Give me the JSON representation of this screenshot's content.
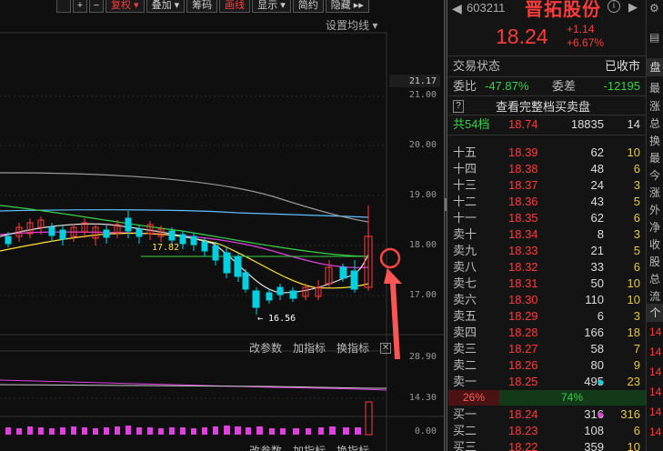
{
  "toolbar": {
    "buttons": [
      "",
      "+",
      "−",
      "复权 ▾",
      "叠加 ▾",
      "筹码",
      "画线",
      "显示 ▾",
      "简约",
      "隐藏 ▸▸"
    ]
  },
  "main_chart": {
    "ma_setting_label": "设置均线 ▾",
    "axis_labels": [
      "21.17",
      "21.00",
      "20.00",
      "19.00",
      "18.00",
      "17.00"
    ],
    "annotations": {
      "ma_level": "17.82",
      "low_marker": "← 16.56"
    }
  },
  "sub_chart_1": {
    "tools": [
      "改参数",
      "加指标",
      "换指标"
    ],
    "close": "✕",
    "axis_label": "28.90"
  },
  "sub_chart_2": {
    "tools": [
      "改参数",
      "加指标",
      "换指标"
    ],
    "axis_labels": [
      "14.30",
      "0.00"
    ]
  },
  "quote": {
    "back_icon": "◀",
    "code": "603211",
    "name": "晋拓股份",
    "info_icon": "i",
    "next_icon": "▶",
    "price": "18.24",
    "change": "+1.14",
    "change_pct": "+6.67%",
    "status_label": "交易状态",
    "status_value": "已收市",
    "weibi_label": "委比",
    "weibi_value": "-47.87%",
    "weicha_label": "委差",
    "weicha_value": "-12195",
    "full_book_btn": "?",
    "full_book_label": "查看完整档买卖盘",
    "total_levels": {
      "label": "共54档",
      "price": "18.74",
      "vol": "18835",
      "count": "14"
    },
    "asks": [
      {
        "level": "十五",
        "price": "18.39",
        "vol": "62",
        "count": "10"
      },
      {
        "level": "十四",
        "price": "18.38",
        "vol": "48",
        "count": "6"
      },
      {
        "level": "十三",
        "price": "18.37",
        "vol": "24",
        "count": "3"
      },
      {
        "level": "十二",
        "price": "18.36",
        "vol": "43",
        "count": "5"
      },
      {
        "level": "十一",
        "price": "18.35",
        "vol": "62",
        "count": "6"
      },
      {
        "level": "卖十",
        "price": "18.34",
        "vol": "8",
        "count": "3"
      },
      {
        "level": "卖九",
        "price": "18.33",
        "vol": "21",
        "count": "5"
      },
      {
        "level": "卖八",
        "price": "18.32",
        "vol": "33",
        "count": "6"
      },
      {
        "level": "卖七",
        "price": "18.31",
        "vol": "50",
        "count": "10"
      },
      {
        "level": "卖六",
        "price": "18.30",
        "vol": "110",
        "count": "10"
      },
      {
        "level": "卖五",
        "price": "18.29",
        "vol": "6",
        "count": "3"
      },
      {
        "level": "卖四",
        "price": "18.28",
        "vol": "166",
        "count": "18"
      },
      {
        "level": "卖三",
        "price": "18.27",
        "vol": "58",
        "count": "7"
      },
      {
        "level": "卖二",
        "price": "18.26",
        "vol": "80",
        "count": "9"
      },
      {
        "level": "卖一",
        "price": "18.25",
        "vol": "495",
        "count": "23"
      }
    ],
    "ratio": {
      "sell": "26%",
      "buy": "74%"
    },
    "bids": [
      {
        "level": "买一",
        "price": "18.24",
        "vol": "316",
        "count": "316"
      },
      {
        "level": "买二",
        "price": "18.23",
        "vol": "108",
        "count": "6"
      },
      {
        "level": "买三",
        "price": "18.22",
        "vol": "359",
        "count": "10"
      }
    ]
  },
  "side": {
    "icons": [
      "⚙",
      "▤"
    ],
    "tab": "盘",
    "chars": [
      "最",
      "涨",
      "总",
      "换",
      "最",
      "今",
      "涨",
      "外",
      "净",
      "收",
      "股",
      "总",
      "流"
    ],
    "tab2": "个",
    "nums": [
      "14",
      "14",
      "14",
      "14",
      "14",
      "14"
    ]
  },
  "colors": {
    "up": "#ff3b3b",
    "down": "#00d0e0",
    "ma5": "#e0e0e0",
    "ma10": "#ffe23a",
    "ma20": "#e040e0",
    "ma30": "#3ad04a",
    "ma60": "#60c0ff"
  }
}
